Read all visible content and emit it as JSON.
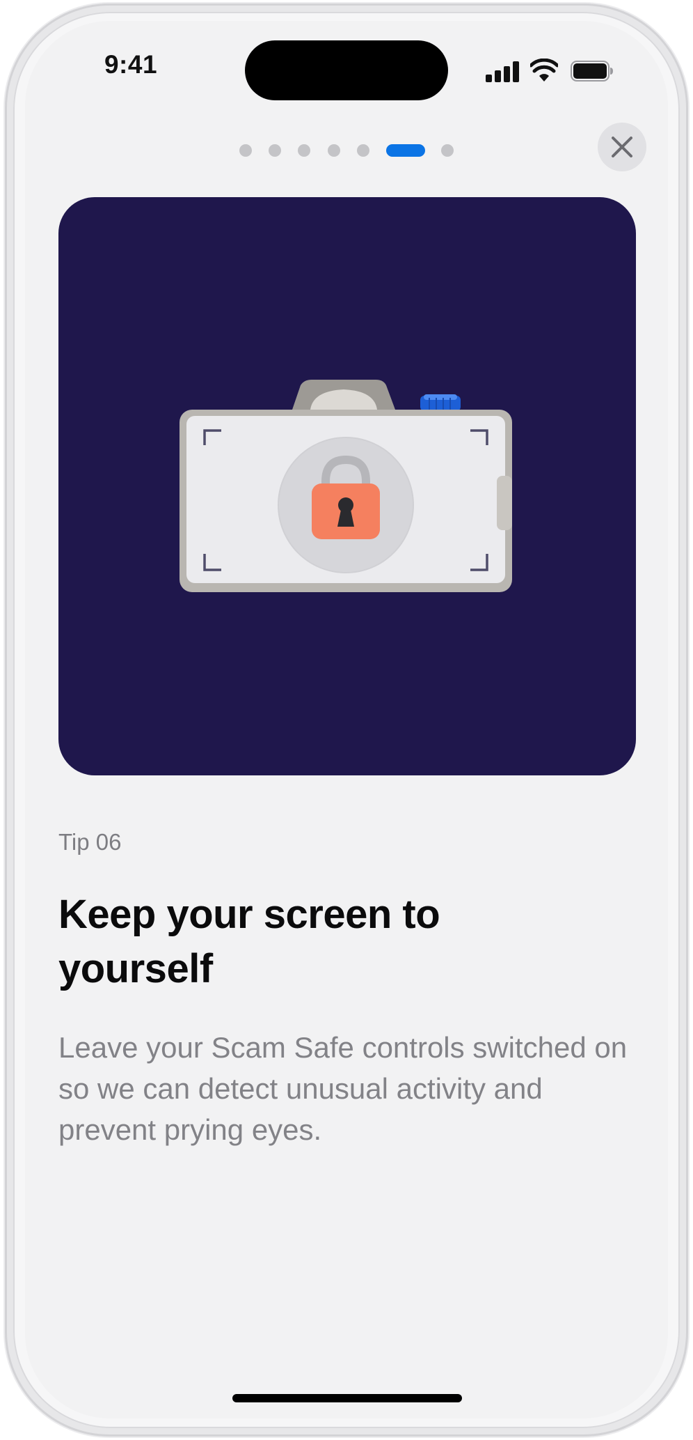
{
  "status_bar": {
    "time": "9:41",
    "signal_icon": "cellular-signal-icon",
    "wifi_icon": "wifi-icon",
    "battery_icon": "battery-full-icon"
  },
  "pager": {
    "page_count": 7,
    "current_page": 6
  },
  "close_button": {
    "icon": "close-icon"
  },
  "hero": {
    "background_color": "#1f174c",
    "illustration": "camera-with-padlock-illustration"
  },
  "content": {
    "tip_label": "Tip 06",
    "title": "Keep your screen to yourself",
    "body": "Leave your Scam Safe controls switched on so we can detect unusual activity and prevent prying eyes."
  },
  "colors": {
    "accent": "#0b74e5",
    "lock": "#f5805f",
    "background": "#f2f2f3"
  }
}
